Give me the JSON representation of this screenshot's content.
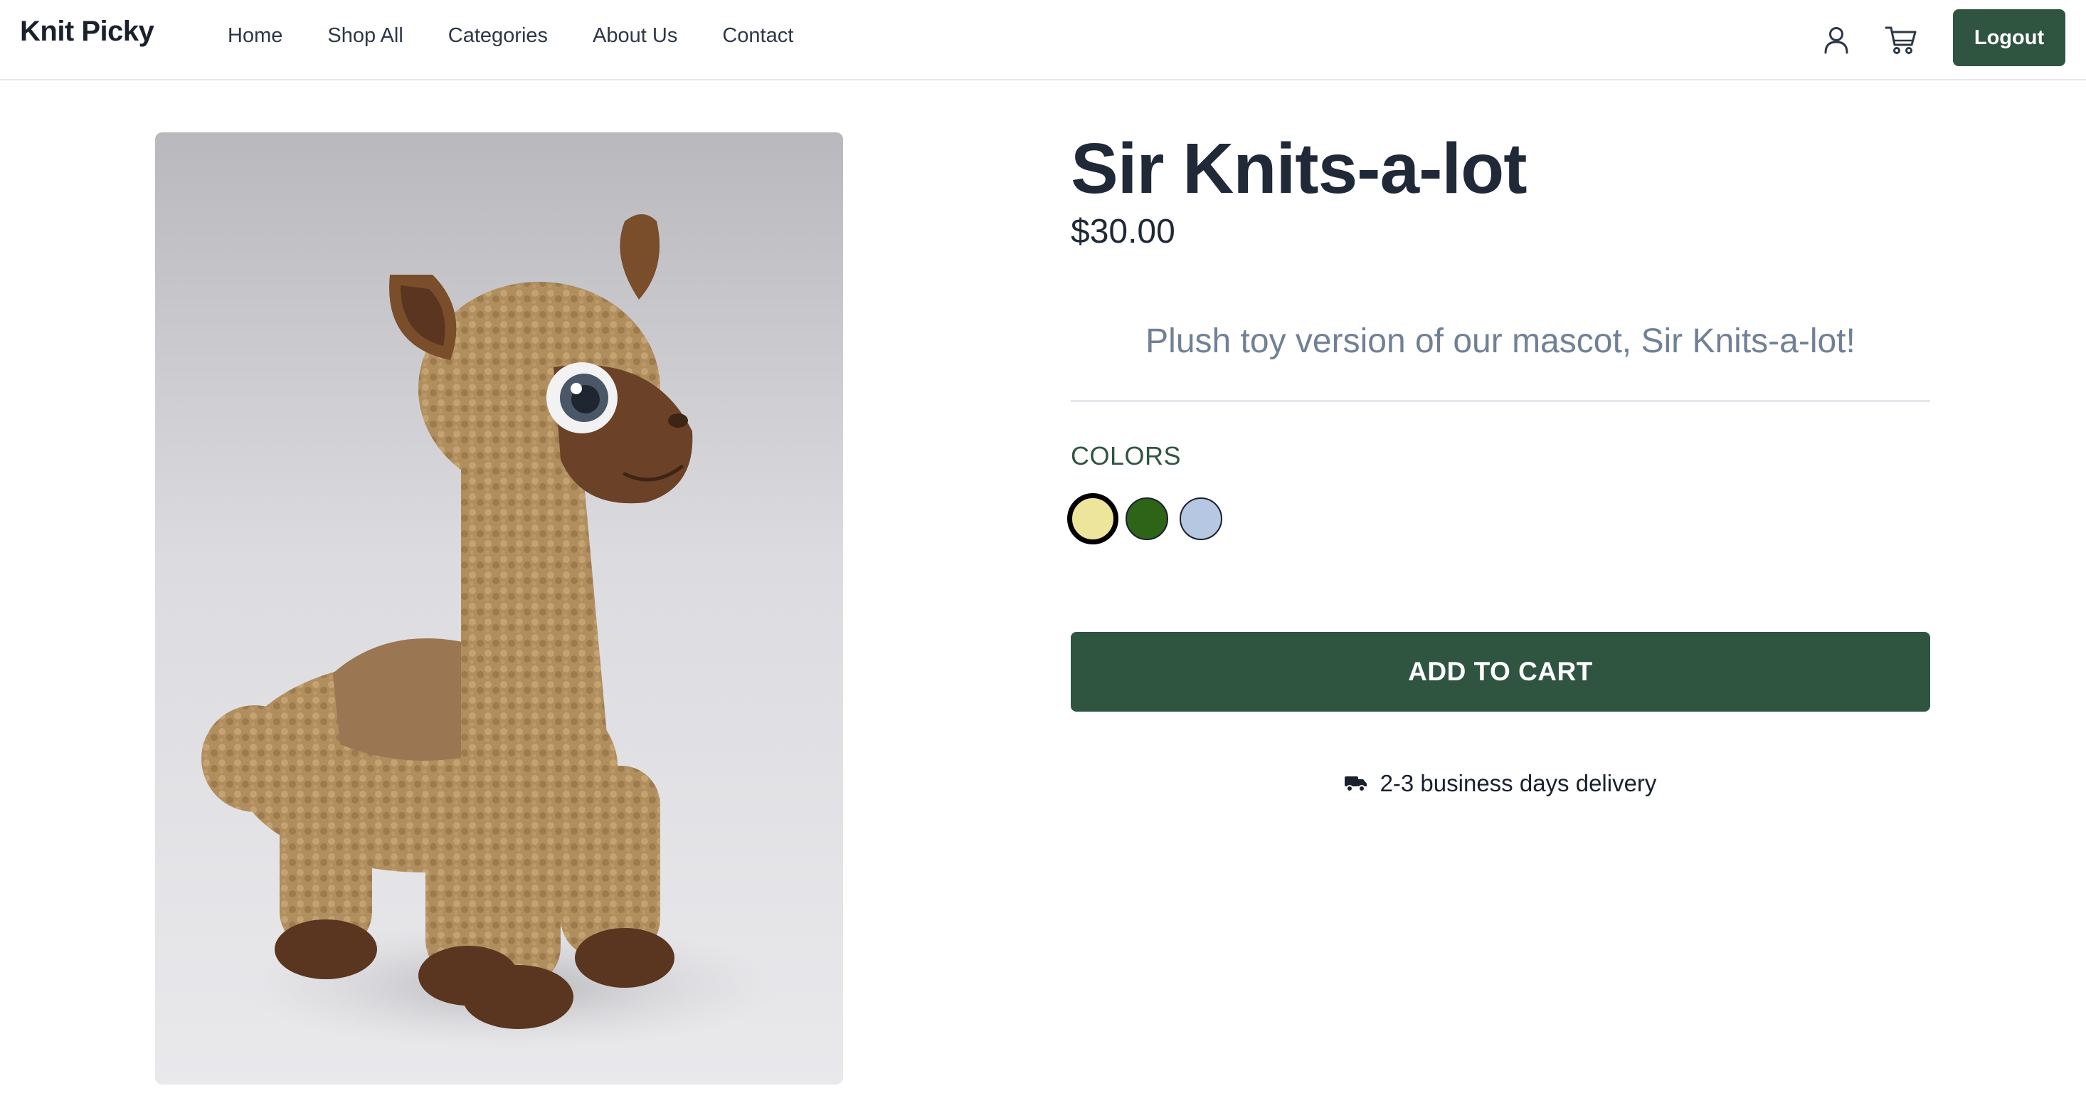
{
  "nav": {
    "brand": "Knit Picky",
    "links": [
      "Home",
      "Shop All",
      "Categories",
      "About Us",
      "Contact"
    ],
    "user_icon": "user-icon",
    "cart_icon": "cart-icon",
    "logout_label": "Logout"
  },
  "product": {
    "image_icon": "llama-plush-photo",
    "title": "Sir Knits-a-lot",
    "price": "$30.00",
    "description": "Plush toy version of our mascot, Sir Knits-a-lot!",
    "colors_label": "COLORS",
    "colors": [
      "#eee59c",
      "#2d6418",
      "#b6c7e2"
    ],
    "selected_color_index": 0,
    "add_to_cart_label": "ADD TO CART",
    "delivery_icon": "truck-icon",
    "delivery_text": "2-3 business days delivery"
  }
}
